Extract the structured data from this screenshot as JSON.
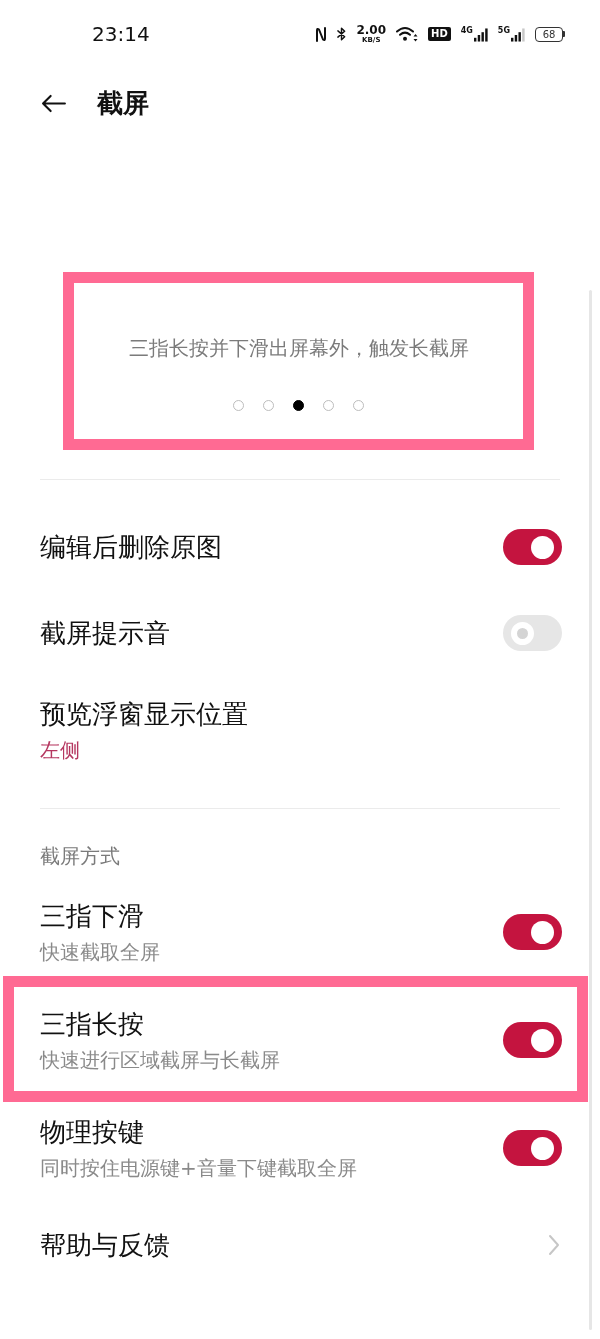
{
  "status_bar": {
    "time": "23:14",
    "network_speed": {
      "value": "2.00",
      "unit": "KB/S"
    },
    "hd_badge": "HD",
    "signals": [
      {
        "label": "4G"
      },
      {
        "label": "5G"
      }
    ],
    "battery": "68"
  },
  "header": {
    "title": "截屏"
  },
  "carousel": {
    "caption": "三指长按并下滑出屏幕外，触发长截屏",
    "highlighted": true,
    "pages": [
      {
        "selected": false
      },
      {
        "selected": false
      },
      {
        "selected": true
      },
      {
        "selected": false
      },
      {
        "selected": false
      }
    ]
  },
  "settings": [
    {
      "kind": "toggle",
      "title": "编辑后删除原图",
      "on": true
    },
    {
      "kind": "toggle",
      "title": "截屏提示音",
      "on": false
    },
    {
      "kind": "value",
      "title": "预览浮窗显示位置",
      "value": "左侧"
    }
  ],
  "screenshot_methods": {
    "header": "截屏方式",
    "items": [
      {
        "kind": "toggle",
        "title": "三指下滑",
        "subtitle": "快速截取全屏",
        "on": true,
        "highlighted": false
      },
      {
        "kind": "toggle",
        "title": "三指长按",
        "subtitle": "快速进行区域截屏与长截屏",
        "on": true,
        "highlighted": true
      },
      {
        "kind": "toggle",
        "title": "物理按键",
        "subtitle": "同时按住电源键+音量下键截取全屏",
        "on": true,
        "highlighted": false
      },
      {
        "kind": "link",
        "title": "帮助与反馈",
        "highlighted": false
      }
    ]
  }
}
